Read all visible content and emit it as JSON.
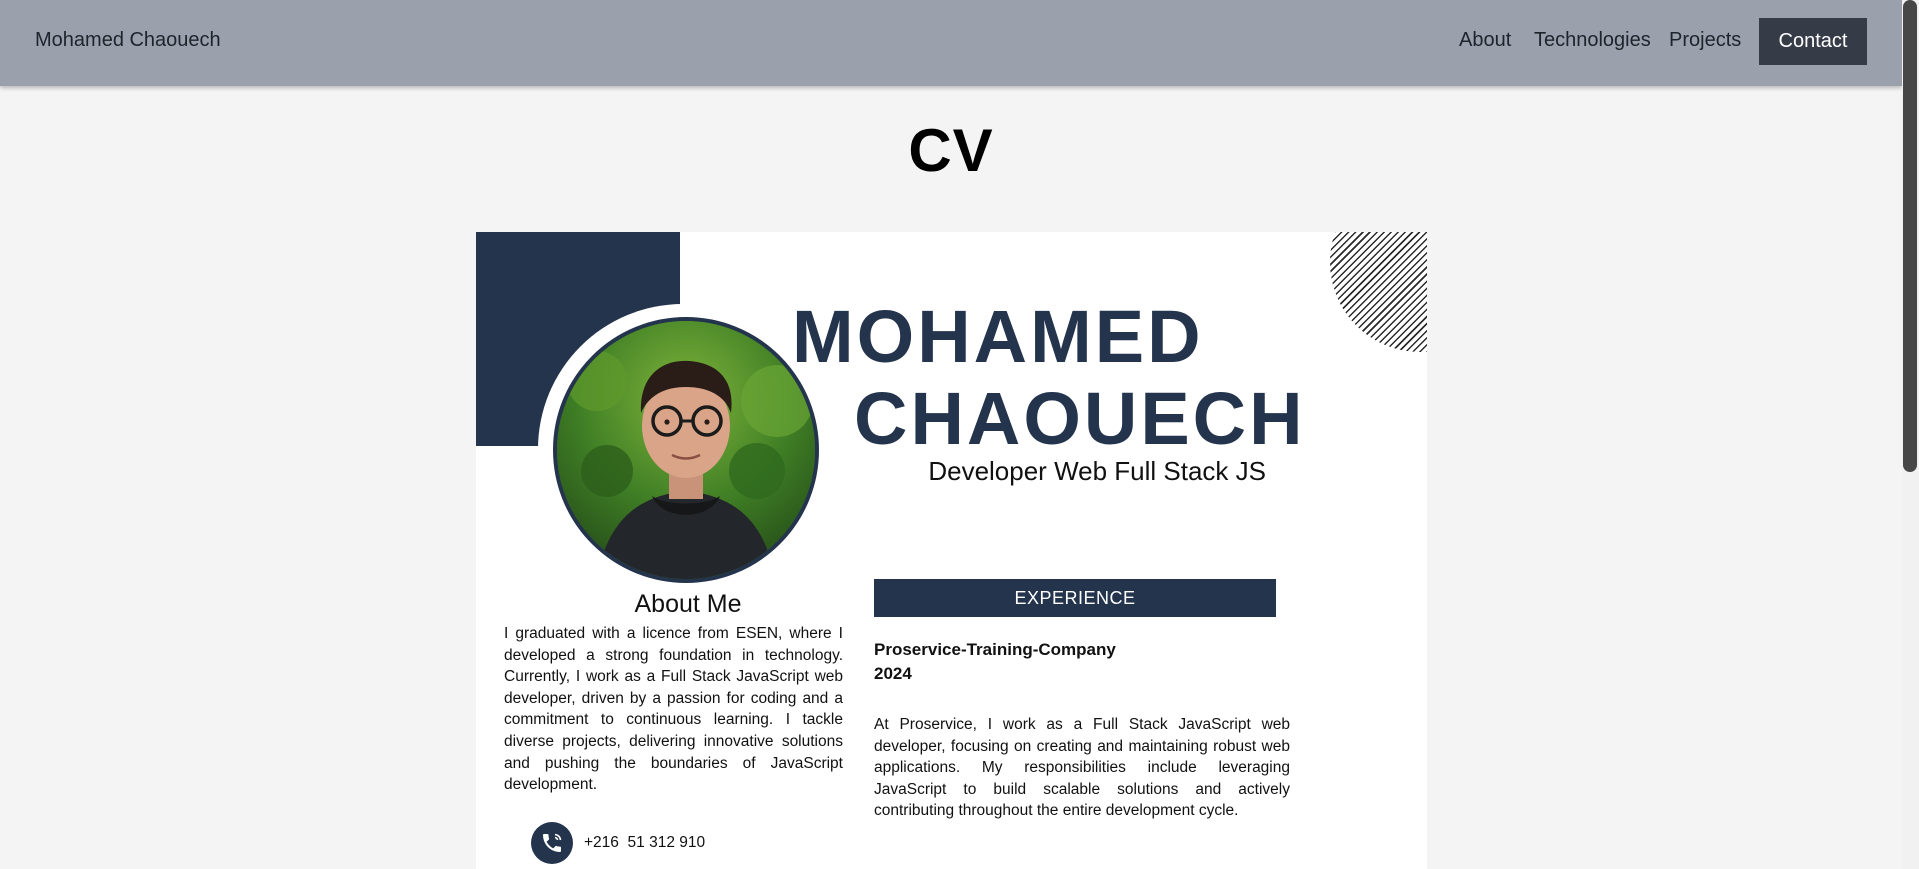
{
  "navbar": {
    "brand": "Mohamed Chaouech",
    "links": [
      {
        "label": "About"
      },
      {
        "label": "Technologies"
      },
      {
        "label": "Projects"
      }
    ],
    "contact_label": "Contact"
  },
  "page": {
    "title": "CV"
  },
  "cv": {
    "first_name": "MOHAMED",
    "last_name": "CHAOUECH",
    "role": "Developer Web Full Stack JS",
    "about": {
      "heading": "About Me",
      "text": "I graduated with a licence from ESEN, where I developed a strong foundation in technology. Currently, I work as a Full Stack JavaScript web developer, driven by a passion for coding and a commitment to continuous learning. I tackle diverse projects, delivering innovative solutions and pushing the boundaries of JavaScript development."
    },
    "contact": {
      "phone": "+216  51 312 910",
      "phone_icon": "phone-icon"
    },
    "experience": {
      "heading": "EXPERIENCE",
      "company": "Proservice-Training-Company",
      "year": "2024",
      "text": "At Proservice, I work as a Full Stack JavaScript web developer, focusing on creating and maintaining robust web applications. My responsibilities include leveraging JavaScript to build scalable solutions and actively contributing throughout the entire development cycle."
    }
  },
  "colors": {
    "navbar_bg": "#9aa1ad",
    "accent_navy": "#24344d",
    "contact_button": "#363b48",
    "page_bg": "#f4f4f4"
  }
}
